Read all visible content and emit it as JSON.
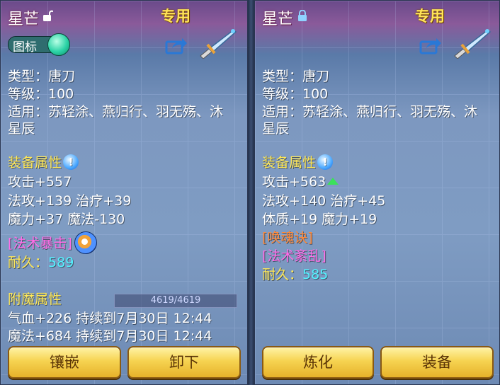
{
  "left": {
    "title": "星芒",
    "lock_state": "unlocked",
    "special_label": "专用",
    "toggle_label": "图标",
    "lines": {
      "type": "类型：唐刀",
      "level": "等级：100",
      "usable1": "适用：苏轻涂、燕归行、羽无殇、沐",
      "usable2": "星辰"
    },
    "equip_attr_title": "装备属性",
    "attack": "攻击+557",
    "stats1": "法攻+139 治疗+39",
    "stats2": "魔力+37 魔法-130",
    "skill": "[法术暴击]",
    "durability_label": "耐久：",
    "durability_value": "589",
    "enchant_title": "附魔属性",
    "hp_bar_text": "4619/4619",
    "enchant1": "气血+226 持续到7月30日 12:44",
    "enchant2": "魔法+684 持续到7月30日 12:44",
    "buttons": [
      "镶嵌",
      "卸下"
    ]
  },
  "right": {
    "title": "星芒",
    "lock_state": "locked",
    "special_label": "专用",
    "lines": {
      "type": "类型：唐刀",
      "level": "等级：100",
      "usable1": "适用：苏轻涂、燕归行、羽无殇、沐",
      "usable2": "星辰"
    },
    "equip_attr_title": "装备属性",
    "attack": "攻击+563",
    "stats1": "法攻+140 治疗+45",
    "stats2": "体质+19 魔力+19",
    "skill1": "[唤魂诀]",
    "skill2": "[法术紊乱]",
    "durability_label": "耐久：",
    "durability_value": "585",
    "buttons": [
      "炼化",
      "装备"
    ]
  }
}
